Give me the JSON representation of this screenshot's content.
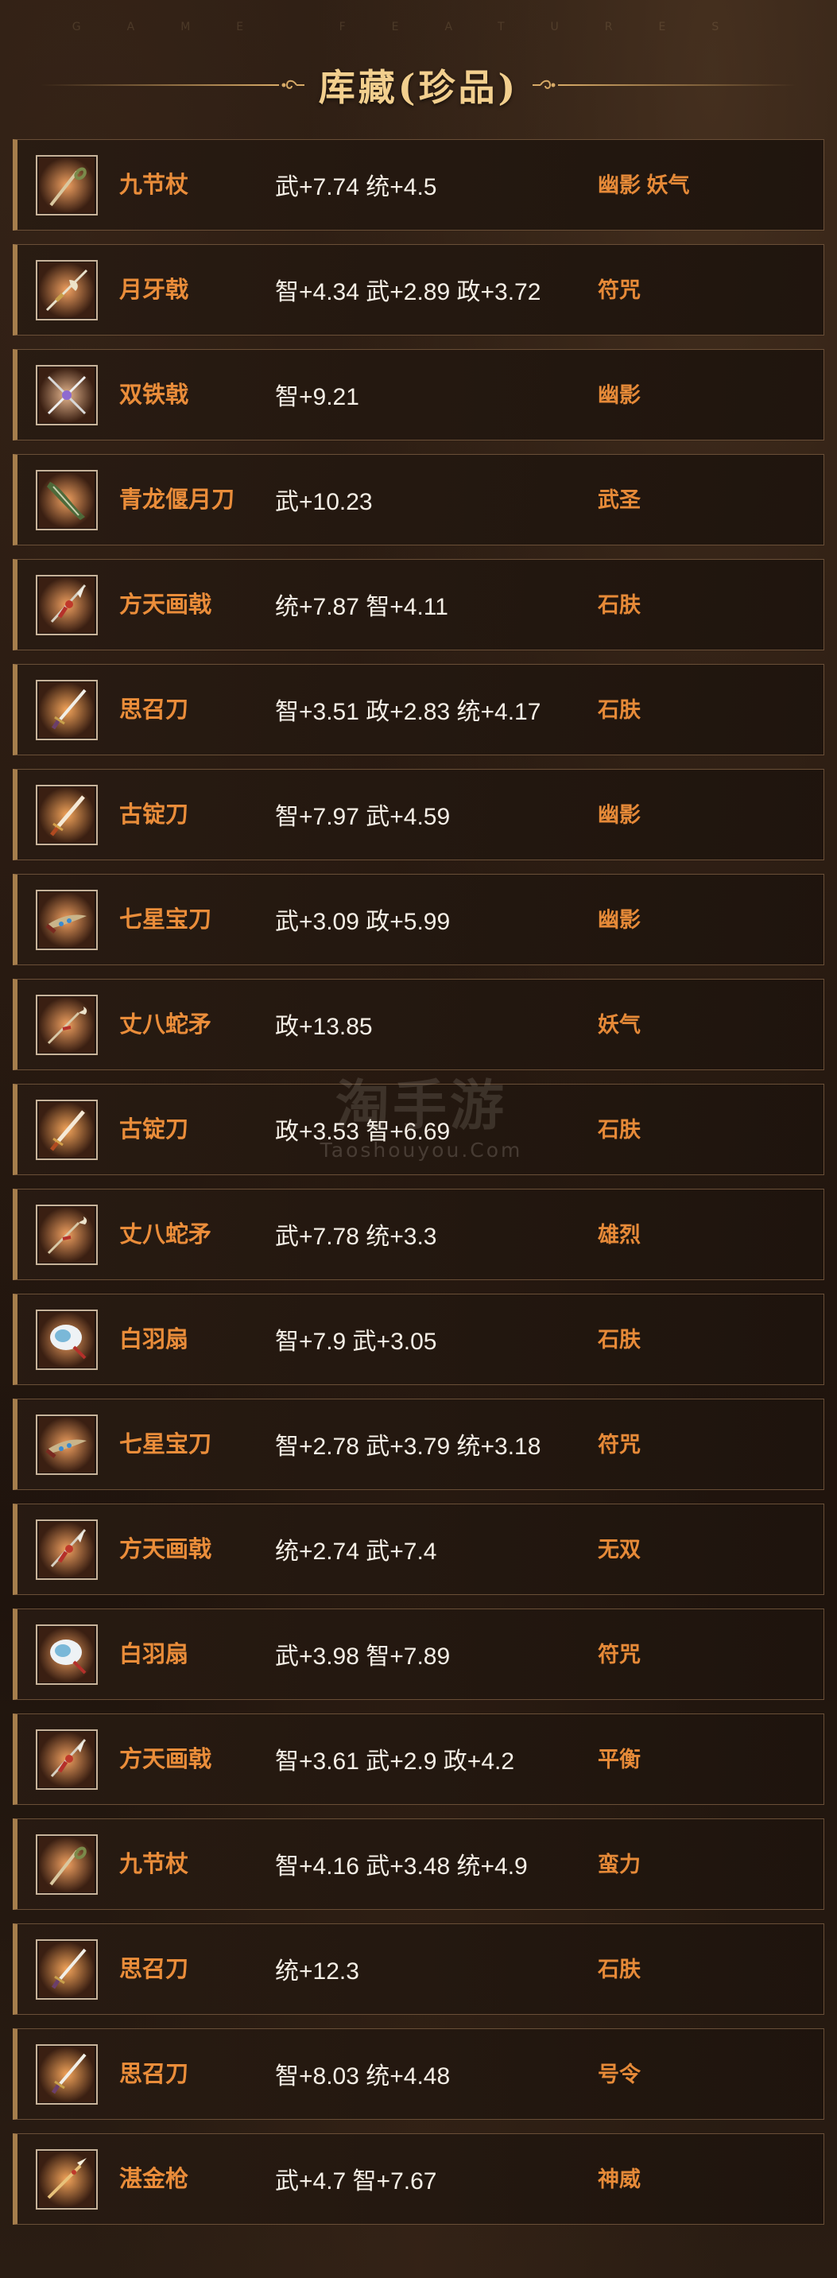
{
  "header": {
    "subtitle": "GAME FEATURES",
    "title": "库藏(珍品)"
  },
  "watermark": {
    "cn": "淘手游",
    "en": "Taoshouyou.Com"
  },
  "items": [
    {
      "name": "九节杖",
      "stats": "武+7.74 统+4.5",
      "tags": "幽影 妖气",
      "icon": "staff-icon"
    },
    {
      "name": "月牙戟",
      "stats": "智+4.34 武+2.89 政+3.72",
      "tags": "符咒",
      "icon": "crescent-halberd-icon"
    },
    {
      "name": "双铁戟",
      "stats": "智+9.21",
      "tags": "幽影",
      "icon": "double-halberd-icon"
    },
    {
      "name": "青龙偃月刀",
      "stats": "武+10.23",
      "tags": "武圣",
      "icon": "glaive-icon"
    },
    {
      "name": "方天画戟",
      "stats": "统+7.87 智+4.11",
      "tags": "石肤",
      "icon": "halberd-icon"
    },
    {
      "name": "思召刀",
      "stats": "智+3.51 政+2.83 统+4.17",
      "tags": "石肤",
      "icon": "sword-icon"
    },
    {
      "name": "古锭刀",
      "stats": "智+7.97 武+4.59",
      "tags": "幽影",
      "icon": "blade-icon"
    },
    {
      "name": "七星宝刀",
      "stats": "武+3.09 政+5.99",
      "tags": "幽影",
      "icon": "ornate-blade-icon"
    },
    {
      "name": "丈八蛇矛",
      "stats": "政+13.85",
      "tags": "妖气",
      "icon": "serpent-spear-icon"
    },
    {
      "name": "古锭刀",
      "stats": "政+3.53 智+6.69",
      "tags": "石肤",
      "icon": "blade-icon"
    },
    {
      "name": "丈八蛇矛",
      "stats": "武+7.78 统+3.3",
      "tags": "雄烈",
      "icon": "serpent-spear-icon"
    },
    {
      "name": "白羽扇",
      "stats": "智+7.9 武+3.05",
      "tags": "石肤",
      "icon": "feather-fan-icon"
    },
    {
      "name": "七星宝刀",
      "stats": "智+2.78 武+3.79 统+3.18",
      "tags": "符咒",
      "icon": "ornate-blade-icon"
    },
    {
      "name": "方天画戟",
      "stats": "统+2.74 武+7.4",
      "tags": "无双",
      "icon": "halberd-icon"
    },
    {
      "name": "白羽扇",
      "stats": "武+3.98 智+7.89",
      "tags": "符咒",
      "icon": "feather-fan-icon"
    },
    {
      "name": "方天画戟",
      "stats": "智+3.61 武+2.9 政+4.2",
      "tags": "平衡",
      "icon": "halberd-icon"
    },
    {
      "name": "九节杖",
      "stats": "智+4.16 武+3.48 统+4.9",
      "tags": "蛮力",
      "icon": "staff-icon"
    },
    {
      "name": "思召刀",
      "stats": "统+12.3",
      "tags": "石肤",
      "icon": "sword-icon"
    },
    {
      "name": "思召刀",
      "stats": "智+8.03 统+4.48",
      "tags": "号令",
      "icon": "sword-icon"
    },
    {
      "name": "湛金枪",
      "stats": "武+4.7 智+7.67",
      "tags": "神威",
      "icon": "spear-icon"
    }
  ]
}
